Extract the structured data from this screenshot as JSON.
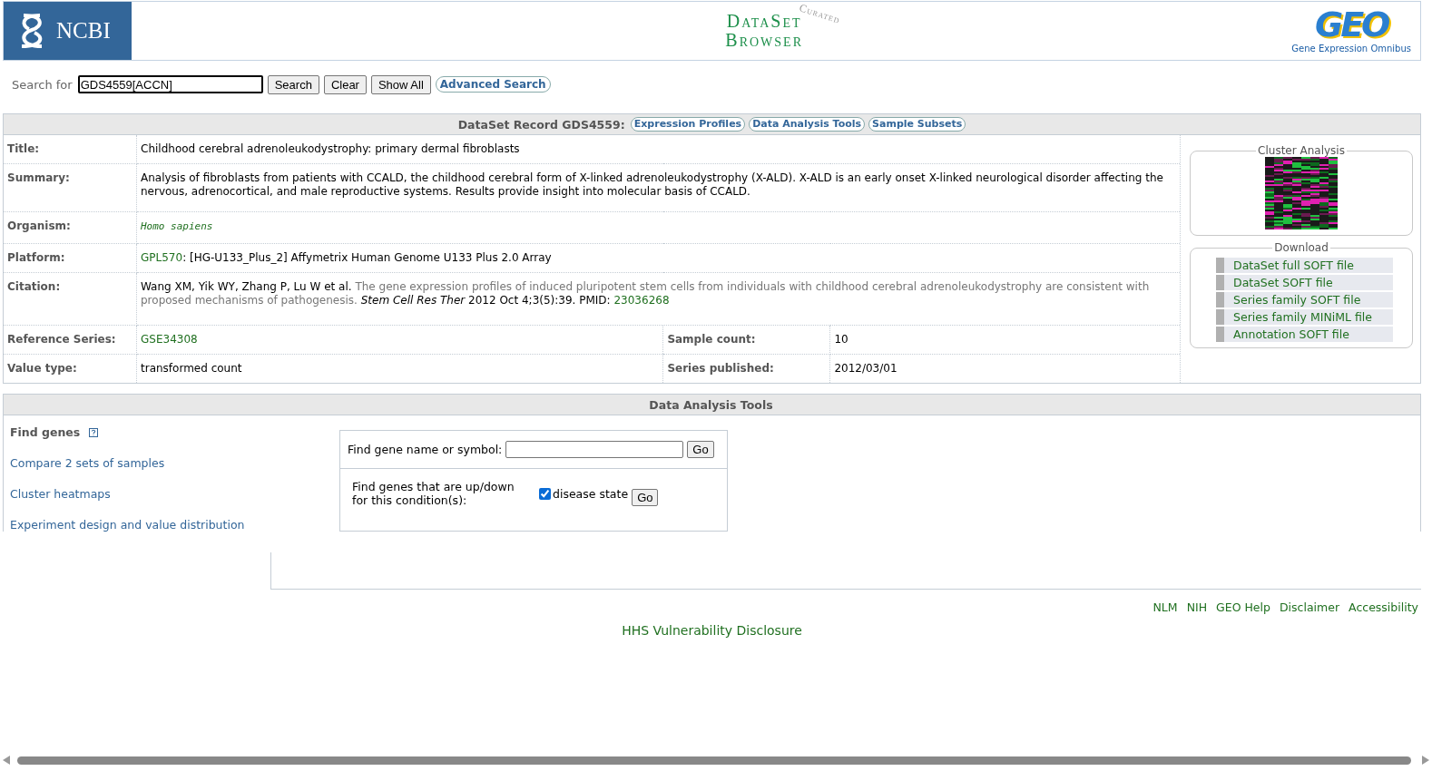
{
  "header": {
    "ncbi_logo": "NCBI",
    "browser_logo": {
      "line_1": "DataSet",
      "line_2": "Browser",
      "stamp": "Curated"
    },
    "geo_logo": {
      "mark": "GEO",
      "caption": "Gene Expression Omnibus"
    }
  },
  "search": {
    "label": "Search for",
    "value": "GDS4559[ACCN]",
    "buttons": [
      {
        "label": "Search",
        "kind": "plain"
      },
      {
        "label": "Clear",
        "kind": "plain"
      },
      {
        "label": "Show All",
        "kind": "plain"
      },
      {
        "label": "Advanced Search",
        "kind": "pill"
      }
    ]
  },
  "record": {
    "heading": "DataSet Record GDS4559:",
    "tabs": [
      {
        "label": "Expression Profiles"
      },
      {
        "label": "Data Analysis Tools"
      },
      {
        "label": "Sample Subsets"
      }
    ],
    "rows": [
      {
        "label": "Title:",
        "value": [
          {
            "text": "Childhood cerebral adrenoleukodystrophy: primary dermal fibroblasts",
            "kind": "plain"
          }
        ]
      },
      {
        "label": "Summary:",
        "value": [
          {
            "text": "Analysis of fibroblasts from patients with CCALD, the childhood cerebral form of X-linked adrenoleukodystrophy (X-ALD). X-ALD is an early onset X-linked neurological disorder affecting the nervous, adrenocortical, and male reproductive systems. Results provide insight into molecular basis of CCALD.",
            "kind": "plain"
          }
        ]
      },
      {
        "label": "Organism:",
        "value": [
          {
            "text": "Homo sapiens",
            "kind": "species"
          }
        ]
      },
      {
        "label": "Platform:",
        "value": [
          {
            "text": "GPL570",
            "kind": "link"
          },
          {
            "text": ": [HG-U133_Plus_2] Affymetrix Human Genome U133 Plus 2.0 Array",
            "kind": "plain"
          }
        ]
      },
      {
        "label": "Citation:",
        "value": [
          {
            "text": "Wang XM, Yik WY, Zhang P, Lu W et al.",
            "kind": "plain"
          },
          {
            "text": "The gene expression profiles of induced pluripotent stem cells from individuals with childhood cerebral adrenoleukodystrophy are consistent with proposed mechanisms of pathogenesis.",
            "kind": "muted"
          },
          {
            "text": "Stem Cell Res Ther",
            "kind": "italic"
          },
          {
            "text": "2012 Oct 4;3(5):39. PMID:",
            "kind": "plain"
          },
          {
            "text": "23036268",
            "kind": "link"
          }
        ]
      }
    ],
    "pairs": [
      {
        "label": "Reference Series:",
        "value": {
          "text": "GSE34308",
          "kind": "link"
        },
        "label_2": "Sample count:",
        "value_2": {
          "text": "10",
          "kind": "plain"
        }
      },
      {
        "label": "Value type:",
        "value": {
          "text": "transformed count",
          "kind": "plain"
        },
        "label_2": "Series published:",
        "value_2": {
          "text": "2012/03/01",
          "kind": "plain"
        }
      }
    ],
    "cluster": {
      "title": "Cluster Analysis"
    },
    "download": {
      "title": "Download",
      "links": [
        "DataSet full SOFT file",
        "DataSet SOFT file",
        "Series family SOFT file",
        "Series family MINiML file",
        "Annotation SOFT file"
      ]
    }
  },
  "tools": {
    "heading": "Data Analysis Tools",
    "menu": [
      {
        "label": "Find genes",
        "selected": true,
        "help": true
      },
      {
        "label": "Compare 2 sets of samples",
        "selected": false,
        "help": false
      },
      {
        "label": "Cluster heatmaps",
        "selected": false,
        "help": false
      },
      {
        "label": "Experiment design and value distribution",
        "selected": false,
        "help": false
      }
    ],
    "gene_search": {
      "label": "Find gene name or symbol:",
      "button": "Go"
    },
    "condition_search": {
      "label": "Find genes that are up/down for this condition(s):",
      "options": [
        {
          "label": "disease state",
          "checked": true
        }
      ],
      "button": "Go"
    }
  },
  "footer": {
    "links": [
      "NLM",
      "NIH",
      "GEO Help",
      "Disclaimer",
      "Accessibility"
    ],
    "disclosure": "HHS Vulnerability Disclosure"
  }
}
